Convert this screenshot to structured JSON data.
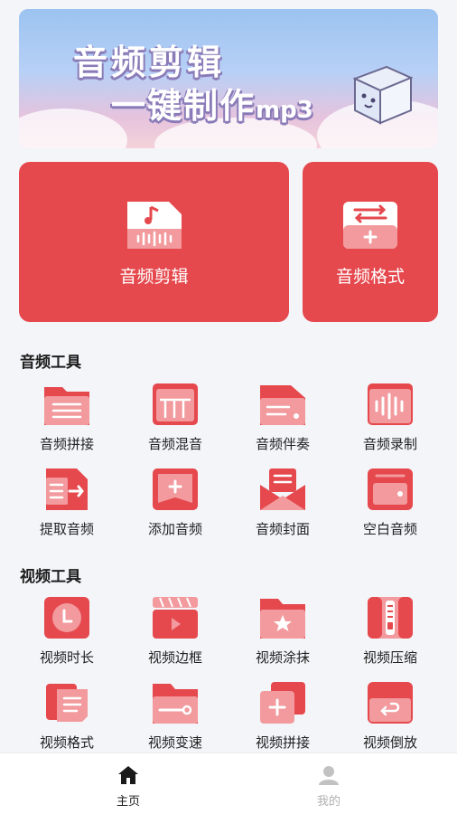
{
  "banner": {
    "line1": "音频剪辑",
    "line2_main": "一键制作",
    "line2_suffix": "mp3"
  },
  "main_cards": [
    {
      "label": "音频剪辑",
      "icon": "audio-file-edit-icon"
    },
    {
      "label": "音频格式",
      "icon": "format-convert-icon"
    }
  ],
  "audio_tools": {
    "title": "音频工具",
    "items": [
      {
        "label": "音频拼接",
        "icon": "folder-list-icon"
      },
      {
        "label": "音频混音",
        "icon": "mixer-icon"
      },
      {
        "label": "音频伴奏",
        "icon": "folder-accompaniment-icon"
      },
      {
        "label": "音频录制",
        "icon": "waveform-record-icon"
      },
      {
        "label": "提取音频",
        "icon": "extract-audio-icon"
      },
      {
        "label": "添加音频",
        "icon": "add-audio-icon"
      },
      {
        "label": "音频封面",
        "icon": "cover-envelope-icon"
      },
      {
        "label": "空白音频",
        "icon": "blank-audio-icon"
      }
    ]
  },
  "video_tools": {
    "title": "视频工具",
    "items": [
      {
        "label": "视频时长",
        "icon": "clock-icon"
      },
      {
        "label": "视频边框",
        "icon": "clapper-frame-icon"
      },
      {
        "label": "视频涂抹",
        "icon": "folder-star-icon"
      },
      {
        "label": "视频压缩",
        "icon": "zip-compress-icon"
      },
      {
        "label": "视频格式",
        "icon": "document-format-icon"
      },
      {
        "label": "视频变速",
        "icon": "folder-speed-icon"
      },
      {
        "label": "视频拼接",
        "icon": "layers-add-icon"
      },
      {
        "label": "视频倒放",
        "icon": "reverse-play-icon"
      }
    ]
  },
  "tabbar": {
    "home": "主页",
    "mine": "我的",
    "active_color": "#1a1a1a",
    "inactive_color": "#b0b0b0"
  },
  "colors": {
    "accent": "#e5484d",
    "accent_light": "#f29a9d",
    "background": "#f4f5f9"
  }
}
